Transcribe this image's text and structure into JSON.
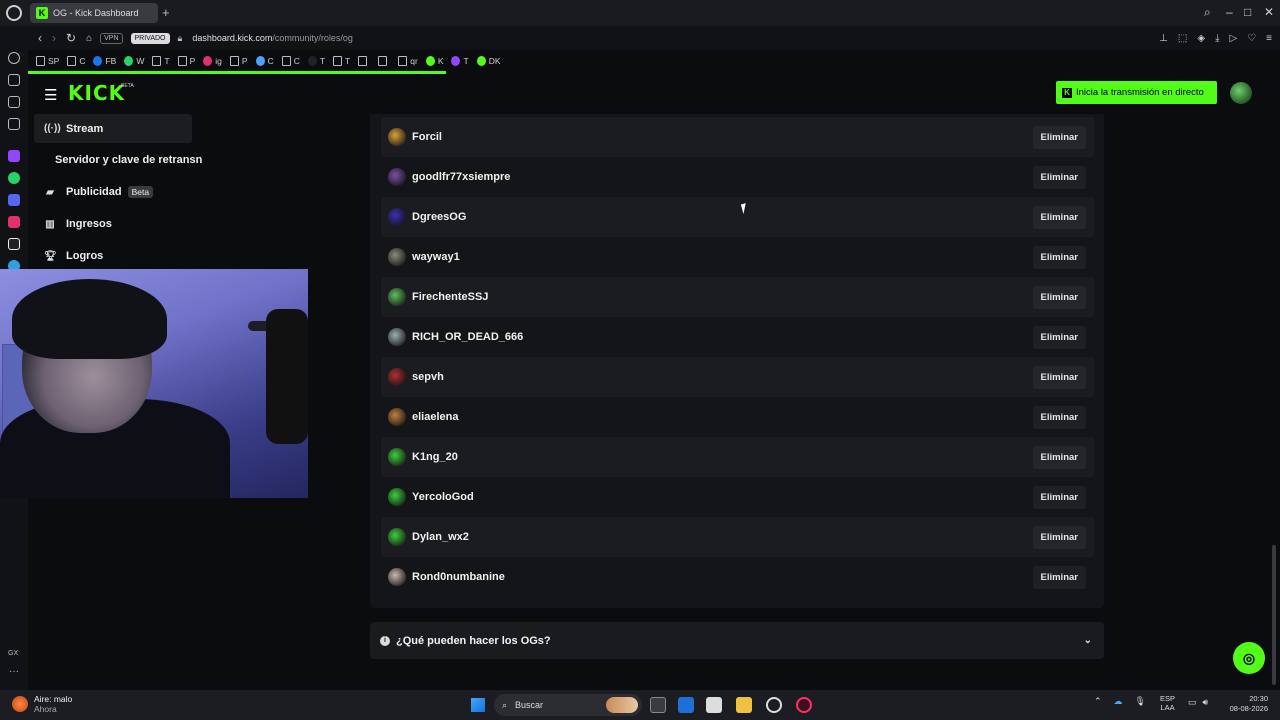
{
  "browser": {
    "tab_title": "OG - Kick Dashboard",
    "vpn_label": "VPN",
    "private_label": "PRIVADO",
    "url_host": "dashboard.kick.com",
    "url_path": "/community/roles/og",
    "bookmarks": [
      {
        "label": "SP",
        "icon": "page-icon"
      },
      {
        "label": "C",
        "icon": "page-icon"
      },
      {
        "label": "FB",
        "icon": "facebook-icon"
      },
      {
        "label": "W",
        "icon": "whatsapp-icon"
      },
      {
        "label": "T",
        "icon": "page-icon"
      },
      {
        "label": "P",
        "icon": "page-icon"
      },
      {
        "label": "ig",
        "icon": "instagram-icon"
      },
      {
        "label": "P",
        "icon": "page-icon"
      },
      {
        "label": "C",
        "icon": "chrome-icon"
      },
      {
        "label": "C",
        "icon": "page-icon"
      },
      {
        "label": "T",
        "icon": "tiktok-icon"
      },
      {
        "label": "T",
        "icon": "page-icon"
      },
      {
        "label": "",
        "icon": "page-icon"
      },
      {
        "label": "",
        "icon": "page-icon"
      },
      {
        "label": "qr",
        "icon": "page-icon"
      },
      {
        "label": "K",
        "icon": "kick-icon"
      },
      {
        "label": "T",
        "icon": "twitch-icon"
      },
      {
        "label": "DK",
        "icon": "kick-icon"
      }
    ]
  },
  "header": {
    "logo": "KICK",
    "logo_badge": "BETA",
    "go_live": "Inicia la transmisión en directo"
  },
  "sidebar": {
    "items": [
      {
        "label": "Stream",
        "icon": "stream-icon",
        "active": true
      },
      {
        "label": "Servidor y clave de retransn",
        "icon": "",
        "active": false
      },
      {
        "label": "Publicidad",
        "icon": "megaphone-icon",
        "badge": "Beta"
      },
      {
        "label": "Ingresos",
        "icon": "chart-icon"
      },
      {
        "label": "Logros",
        "icon": "trophy-icon"
      }
    ]
  },
  "og_list": {
    "remove_label": "Eliminar",
    "users": [
      {
        "name": "Forcil",
        "color": "#d9a23a"
      },
      {
        "name": "goodlfr77xsiempre",
        "color": "#7a4fa8"
      },
      {
        "name": "DgreesOG",
        "color": "#3a2fb0"
      },
      {
        "name": "wayway1",
        "color": "#8a8a7a"
      },
      {
        "name": "FirechenteSSJ",
        "color": "#5fbf5f"
      },
      {
        "name": "RICH_OR_DEAD_666",
        "color": "#9ab0b0"
      },
      {
        "name": "sepvh",
        "color": "#b03030"
      },
      {
        "name": "eliaelena",
        "color": "#c08040"
      },
      {
        "name": "K1ng_20",
        "color": "#3ccf3c"
      },
      {
        "name": "YercoloGod",
        "color": "#3ccf3c"
      },
      {
        "name": "Dylan_wx2",
        "color": "#3ccf3c"
      },
      {
        "name": "Rond0numbanine",
        "color": "#c9b8b0"
      }
    ]
  },
  "faq": {
    "title": "¿Qué pueden hacer los OGs?"
  },
  "taskbar": {
    "weather_title": "Aire: malo",
    "weather_sub": "Ahora",
    "search_placeholder": "Buscar",
    "lang_top": "ESP",
    "lang_bottom": "LAA",
    "time": "20:30",
    "date": "08-08-2026"
  },
  "sidestrip_label": "GX"
}
